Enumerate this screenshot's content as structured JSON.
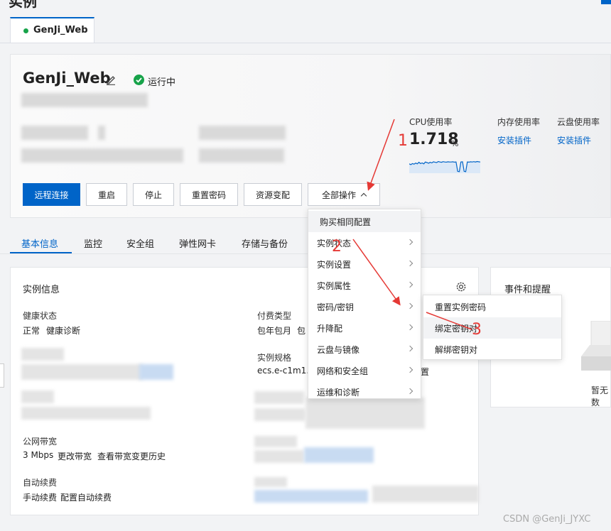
{
  "header": {
    "title_partial": "实例"
  },
  "tab": {
    "label": "GenJi_Web"
  },
  "instance": {
    "name": "GenJi_Web",
    "status": "运行中"
  },
  "metrics": {
    "cpu_label": "CPU使用率",
    "cpu_value": "1.718",
    "cpu_unit": "%",
    "cpu_sparkline": [
      0.6,
      0.55,
      0.62,
      0.58,
      0.65,
      0.6,
      0.7,
      0.62,
      0.66,
      0.6,
      0.72,
      0.68,
      0.64,
      0.7,
      0.66,
      0.73,
      0.7,
      0.68,
      0.75,
      0.72,
      0.7,
      0.74,
      0.72,
      0.71,
      0.73,
      0.72,
      0.72,
      0.73,
      0.71,
      0.72,
      0.12,
      0.1,
      0.72,
      0.73,
      0.12,
      0.1,
      0.72,
      0.71,
      0.73,
      0.72,
      0.74,
      0.72,
      0.75,
      0.73,
      0.72
    ],
    "mem_label": "内存使用率",
    "mem_action": "安装插件",
    "disk_label": "云盘使用率",
    "disk_action": "安装插件"
  },
  "actions": {
    "remote": "远程连接",
    "restart": "重启",
    "stop": "停止",
    "reset_password": "重置密码",
    "resize": "资源变配",
    "all_ops": "全部操作"
  },
  "dropdown": {
    "items": [
      {
        "label": "购买相同配置"
      },
      {
        "label": "实例状态"
      },
      {
        "label": "实例设置"
      },
      {
        "label": "实例属性"
      },
      {
        "label": "密码/密钥"
      },
      {
        "label": "升降配"
      },
      {
        "label": "云盘与镜像"
      },
      {
        "label": "网络和安全组"
      },
      {
        "label": "运维和诊断"
      }
    ]
  },
  "submenu": {
    "items": [
      {
        "label": "重置实例密码"
      },
      {
        "label": "绑定密钥对"
      },
      {
        "label": "解绑密钥对"
      }
    ]
  },
  "annotations": {
    "n1": "1",
    "n2": "2",
    "n3": "3",
    "arrow_color": "#e53935"
  },
  "nav": {
    "tabs": [
      {
        "label": "基本信息"
      },
      {
        "label": "监控"
      },
      {
        "label": "安全组"
      },
      {
        "label": "弹性网卡"
      },
      {
        "label": "存储与备份"
      }
    ]
  },
  "info": {
    "title": "实例信息",
    "health_label": "健康状态",
    "health_value": "正常",
    "health_link": "健康诊断",
    "billing_label": "付费类型",
    "billing_value": "包年包月",
    "billing_link_partial": "包",
    "spec_label": "实例规格",
    "spec_value_partial": "ecs.e-c1m1.la",
    "spec_link_partial": "置",
    "bandwidth_label": "公网带宽",
    "bandwidth_value": "3 Mbps",
    "bandwidth_link1": "更改带宽",
    "bandwidth_link2": "查看带宽变更历史",
    "renew_label": "自动续费",
    "renew_value": "手动续费",
    "renew_link": "配置自动续费"
  },
  "events": {
    "title": "事件和提醒",
    "empty_partial": "暂无数"
  },
  "watermark": "CSDN @GenJi_JYXC",
  "colors": {
    "accent": "#0064c8",
    "success": "#17a34a",
    "annotation": "#e53935"
  }
}
